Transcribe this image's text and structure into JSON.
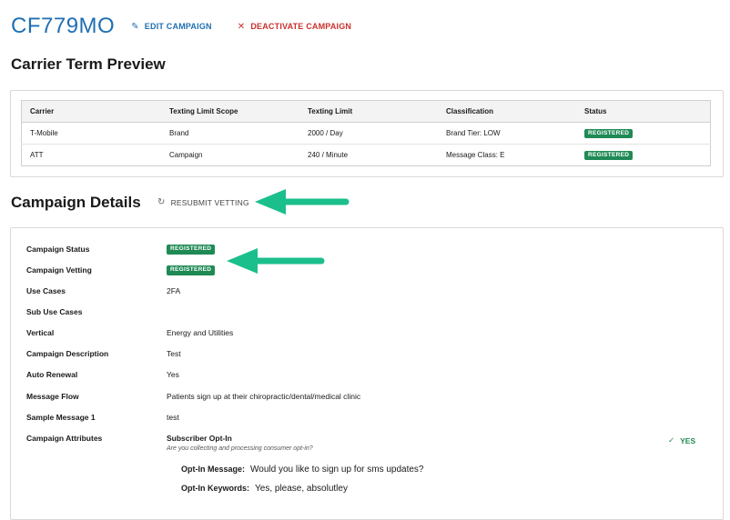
{
  "header": {
    "campaign_id": "CF779MO",
    "edit_label": "EDIT CAMPAIGN",
    "deactivate_label": "DEACTIVATE CAMPAIGN"
  },
  "carrier_section": {
    "title": "Carrier Term Preview",
    "columns": [
      "Carrier",
      "Texting Limit Scope",
      "Texting Limit",
      "Classification",
      "Status"
    ],
    "rows": [
      {
        "carrier": "T-Mobile",
        "scope": "Brand",
        "limit": "2000 / Day",
        "classification": "Brand Tier: LOW",
        "status": "REGISTERED"
      },
      {
        "carrier": "ATT",
        "scope": "Campaign",
        "limit": "240 / Minute",
        "classification": "Message Class: E",
        "status": "REGISTERED"
      }
    ]
  },
  "details_section": {
    "title": "Campaign Details",
    "resubmit_label": "RESUBMIT VETTING",
    "fields": [
      {
        "label": "Campaign Status",
        "value": "REGISTERED"
      },
      {
        "label": "Campaign Vetting",
        "value": "REGISTERED"
      },
      {
        "label": "Use Cases",
        "value": "2FA"
      },
      {
        "label": "Sub Use Cases",
        "value": ""
      },
      {
        "label": "Vertical",
        "value": "Energy and Utilities"
      },
      {
        "label": "Campaign Description",
        "value": "Test"
      },
      {
        "label": "Auto Renewal",
        "value": "Yes"
      },
      {
        "label": "Message Flow",
        "value": "Patients sign up at their chiropractic/dental/medical clinic"
      },
      {
        "label": "Sample Message 1",
        "value": "test"
      },
      {
        "label": "Campaign Attributes",
        "value": ""
      }
    ],
    "attribute": {
      "title": "Subscriber Opt-In",
      "subtitle": "Are you collecting and processing consumer opt-in?",
      "answer": "YES",
      "optin_message_label": "Opt-In Message:",
      "optin_message": "Would you like to sign up for sms updates?",
      "optin_keywords_label": "Opt-In Keywords:",
      "optin_keywords": "Yes, please, absolutley"
    }
  },
  "colors": {
    "accent_blue": "#1f6fb2",
    "danger_red": "#c9302c",
    "status_green": "#1f8a55",
    "arrow_green": "#1bbf8c"
  },
  "icons": [
    "pencil-icon",
    "close-icon",
    "refresh-icon",
    "checkmark-icon",
    "arrow-left-icon"
  ]
}
